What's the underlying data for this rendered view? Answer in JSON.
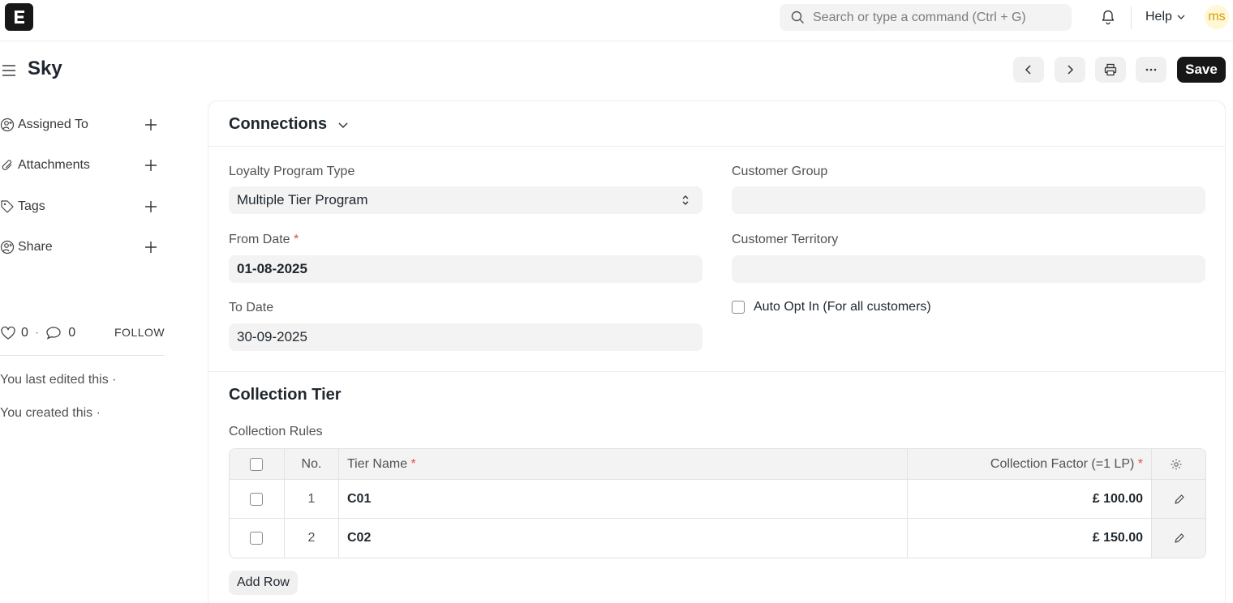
{
  "navbar": {
    "search_placeholder": "Search or type a command (Ctrl + G)",
    "help_label": "Help",
    "avatar_initials": "ms"
  },
  "page": {
    "title": "Sky",
    "save_label": "Save"
  },
  "sidebar": {
    "items": [
      {
        "label": "Assigned To",
        "icon": "user-plus-icon"
      },
      {
        "label": "Attachments",
        "icon": "paperclip-icon"
      },
      {
        "label": "Tags",
        "icon": "tag-icon"
      },
      {
        "label": "Share",
        "icon": "share-user-icon"
      }
    ],
    "likes": "0",
    "comments": "0",
    "follow_label": "FOLLOW",
    "last_edited": "You last edited this ·",
    "created": "You created this ·"
  },
  "connections": {
    "title": "Connections"
  },
  "form": {
    "loyalty_program_type": {
      "label": "Loyalty Program Type",
      "value": "Multiple Tier Program"
    },
    "from_date": {
      "label": "From Date",
      "value": "01-08-2025"
    },
    "to_date": {
      "label": "To Date",
      "value": "30-09-2025"
    },
    "customer_group": {
      "label": "Customer Group",
      "value": ""
    },
    "customer_territory": {
      "label": "Customer Territory",
      "value": ""
    },
    "auto_opt_in": {
      "label": "Auto Opt In (For all customers)",
      "checked": false
    },
    "required_mark": "*"
  },
  "collection_tier": {
    "title": "Collection Tier",
    "table_label": "Collection Rules",
    "columns": {
      "no": "No.",
      "tier_name": "Tier Name",
      "collection_factor": "Collection Factor (=1 LP)"
    },
    "rows": [
      {
        "no": "1",
        "tier_name": "C01",
        "collection_factor": "£ 100.00"
      },
      {
        "no": "2",
        "tier_name": "C02",
        "collection_factor": "£ 150.00"
      }
    ],
    "add_row_label": "Add Row"
  },
  "colors": {
    "primary_button": "#171717",
    "field_background": "#f3f3f3",
    "required": "#e24c4c",
    "avatar_text": "#d39e00"
  }
}
